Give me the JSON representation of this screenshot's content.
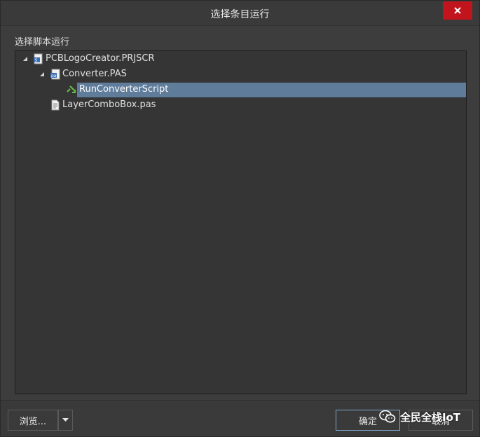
{
  "window": {
    "title": "选择条目运行"
  },
  "section": {
    "label": "选择脚本运行"
  },
  "tree": {
    "nodes": [
      {
        "label": "PCBLogoCreator.PRJSCR",
        "icon": "project-script-icon",
        "expanded": true
      },
      {
        "label": "Converter.PAS",
        "icon": "pascal-file-icon",
        "expanded": true
      },
      {
        "label": "RunConverterScript",
        "icon": "run-procedure-icon",
        "selected": true
      },
      {
        "label": "LayerComboBox.pas",
        "icon": "document-icon"
      }
    ]
  },
  "footer": {
    "browse_label": "浏览...",
    "ok_label": "确定",
    "cancel_label": "取消"
  },
  "watermark": {
    "text": "全民全栈IoT"
  },
  "colors": {
    "close_red": "#c1141c",
    "selection": "#5f7c9a",
    "primary_border": "#7fa4c9"
  }
}
